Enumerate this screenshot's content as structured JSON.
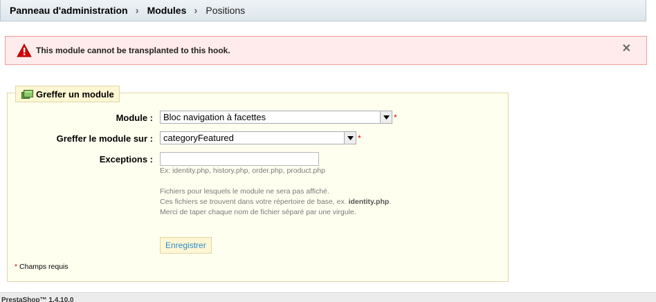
{
  "breadcrumb": {
    "items": [
      "Panneau d'administration",
      "Modules",
      "Positions"
    ],
    "separator": "›"
  },
  "error": {
    "message": "This module cannot be transplanted to this hook.",
    "close_glyph": "✕",
    "icon": "warning-icon",
    "color": "#d60000"
  },
  "form": {
    "legend": "Greffer un module",
    "legend_icon": "module-icon",
    "module_label": "Module :",
    "module_value": "Bloc navigation à facettes",
    "hook_label": "Greffer le module sur :",
    "hook_value": "categoryFeatured",
    "required_mark": "*",
    "exceptions_label": "Exceptions :",
    "exceptions_value": "",
    "exceptions_example": "Ex: identity.php, history.php, order.php, product.php",
    "help_line1": "Fichiers pour lesquels le module ne sera pas affiché.",
    "help_line2_prefix": "Ces fichiers se trouvent dans votre répertoire de base, ex. ",
    "help_line2_bold": "identity.php",
    "help_line2_suffix": ".",
    "help_line3": "Merci de taper chaque nom de fichier séparé par une virgule.",
    "save_label": "Enregistrer",
    "required_note": "Champs requis"
  },
  "footer": {
    "text": "PrestaShop™ 1.4.10.0"
  },
  "colors": {
    "accent_link": "#268ccd",
    "error_bg": "#ffebeb",
    "fieldset_bg": "#fffff0",
    "required": "#cc0000"
  }
}
